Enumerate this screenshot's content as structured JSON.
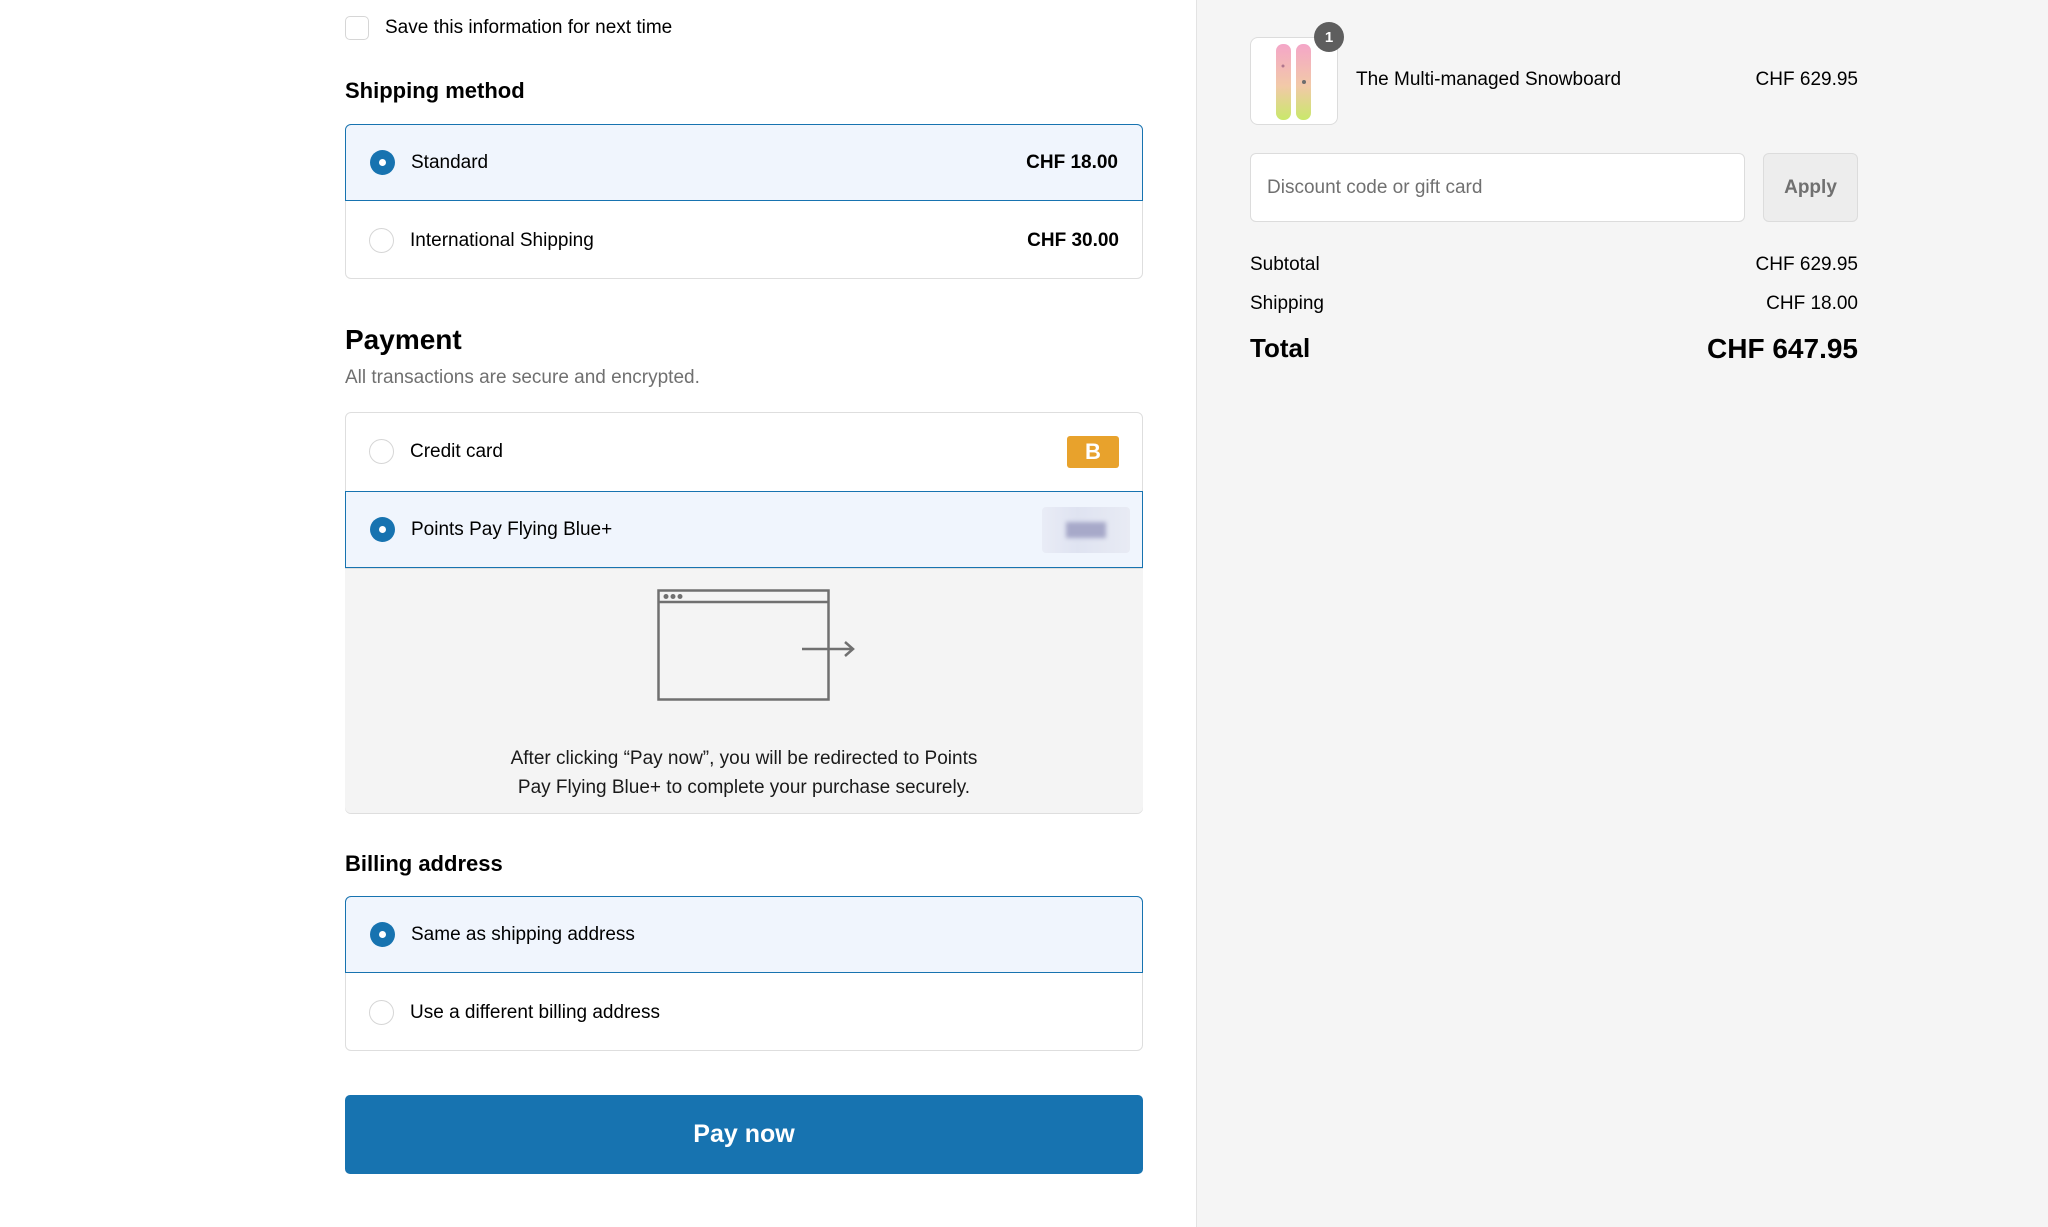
{
  "checkout": {
    "save_info_label": "Save this information for next time",
    "shipping": {
      "title": "Shipping method",
      "options": [
        {
          "label": "Standard",
          "price": "CHF 18.00",
          "selected": true
        },
        {
          "label": "International Shipping",
          "price": "CHF 30.00",
          "selected": false
        }
      ]
    },
    "payment": {
      "title": "Payment",
      "subtitle": "All transactions are secure and encrypted.",
      "options": [
        {
          "label": "Credit card",
          "badge": "B",
          "selected": false
        },
        {
          "label": "Points Pay Flying Blue+",
          "selected": true
        }
      ],
      "redirect_text": "After clicking “Pay now”, you will be redirected to Points Pay Flying Blue+ to complete your purchase securely."
    },
    "billing": {
      "title": "Billing address",
      "options": [
        {
          "label": "Same as shipping address",
          "selected": true
        },
        {
          "label": "Use a different billing address",
          "selected": false
        }
      ]
    },
    "pay_button": "Pay now"
  },
  "summary": {
    "product": {
      "name": "The Multi-managed Snowboard",
      "price": "CHF 629.95",
      "quantity": "1"
    },
    "discount": {
      "placeholder": "Discount code or gift card",
      "button": "Apply"
    },
    "subtotal": {
      "label": "Subtotal",
      "value": "CHF 629.95"
    },
    "shipping": {
      "label": "Shipping",
      "value": "CHF 18.00"
    },
    "total": {
      "label": "Total",
      "value": "CHF 647.95"
    }
  },
  "colors": {
    "accent": "#1773b0",
    "selected_bg": "#f0f5fd",
    "summary_bg": "#f5f5f5",
    "card_badge": "#e8a22c"
  }
}
